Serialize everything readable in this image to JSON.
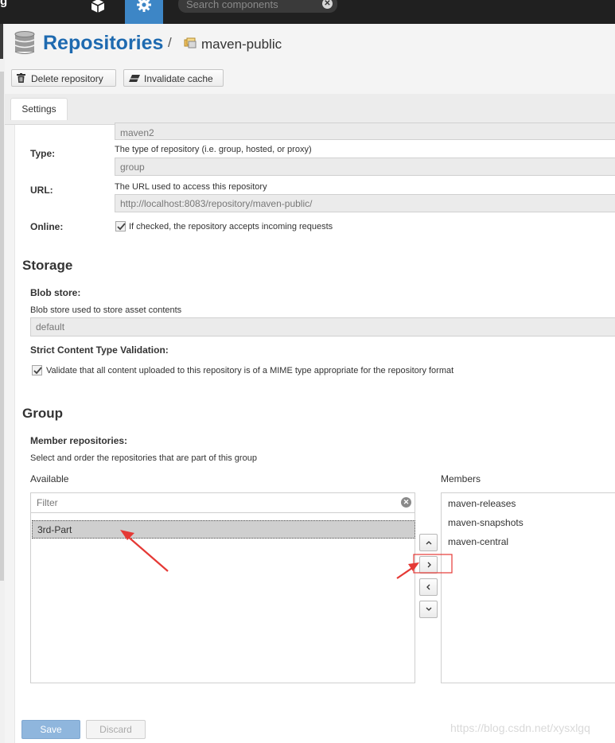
{
  "topbar": {
    "brand": "g",
    "search_placeholder": "Search components",
    "search_clear_glyph": "✕",
    "browse_icon": "cube-icon",
    "admin_icon": "gear-icon",
    "active_color": "#3d86c6"
  },
  "header": {
    "title": "Repositories",
    "separator": "/",
    "current": "maven-public",
    "title_color": "#1e6ab0"
  },
  "toolbar": {
    "delete_label": "Delete repository",
    "invalidate_label": "Invalidate cache"
  },
  "tabs": [
    {
      "label": "Settings"
    }
  ],
  "settings": {
    "format_value": "maven2",
    "type": {
      "label": "Type:",
      "help": "The type of repository (i.e. group, hosted, or proxy)",
      "value": "group"
    },
    "url": {
      "label": "URL:",
      "help": "The URL used to access this repository",
      "value": "http://localhost:8083/repository/maven-public/"
    },
    "online": {
      "label": "Online:",
      "checkbox_label": "If checked, the repository accepts incoming requests",
      "checked": true
    }
  },
  "storage": {
    "heading": "Storage",
    "blob_label": "Blob store:",
    "blob_help": "Blob store used to store asset contents",
    "blob_value": "default",
    "strict_label": "Strict Content Type Validation:",
    "strict_checkbox_label": "Validate that all content uploaded to this repository is of a MIME type appropriate for the repository format",
    "strict_checked": true
  },
  "group": {
    "heading": "Group",
    "member_label": "Member repositories:",
    "member_help": "Select and order the repositories that are part of this group",
    "available_label": "Available",
    "members_label": "Members",
    "filter_placeholder": "Filter",
    "filter_clear_glyph": "✕",
    "available_items": [
      "3rd-Part"
    ],
    "members": [
      "maven-releases",
      "maven-snapshots",
      "maven-central"
    ]
  },
  "footer": {
    "save_label": "Save",
    "discard_label": "Discard"
  },
  "watermark": "https://blog.csdn.net/xysxlgq",
  "annotation_color": "#e53935"
}
